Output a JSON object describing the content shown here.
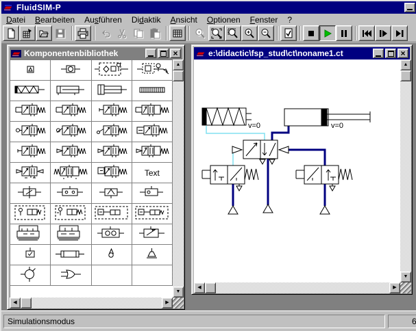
{
  "window": {
    "title": "FluidSIM-P"
  },
  "menu": {
    "items": [
      {
        "name": "datei",
        "pre": "",
        "key": "D",
        "post": "atei"
      },
      {
        "name": "bearbeiten",
        "pre": "",
        "key": "B",
        "post": "earbeiten"
      },
      {
        "name": "ausfuehren",
        "pre": "Au",
        "key": "s",
        "post": "führen"
      },
      {
        "name": "didaktik",
        "pre": "Di",
        "key": "d",
        "post": "aktik"
      },
      {
        "name": "ansicht",
        "pre": "",
        "key": "A",
        "post": "nsicht"
      },
      {
        "name": "optionen",
        "pre": "",
        "key": "O",
        "post": "ptionen"
      },
      {
        "name": "fenster",
        "pre": "",
        "key": "F",
        "post": "enster"
      },
      {
        "name": "hilfe",
        "pre": "?",
        "key": "",
        "post": ""
      }
    ]
  },
  "toolbar": {
    "buttons": [
      {
        "name": "new",
        "icon": "new",
        "state": "normal"
      },
      {
        "name": "new-circuit",
        "icon": "new-circuit",
        "state": "normal"
      },
      {
        "name": "open",
        "icon": "open",
        "state": "normal"
      },
      {
        "name": "save",
        "icon": "save",
        "state": "disabled"
      },
      {
        "sep": true
      },
      {
        "name": "print",
        "icon": "print",
        "state": "normal"
      },
      {
        "sep": true
      },
      {
        "name": "undo",
        "icon": "undo",
        "state": "disabled"
      },
      {
        "name": "cut",
        "icon": "cut",
        "state": "disabled"
      },
      {
        "name": "copy",
        "icon": "copy",
        "state": "disabled"
      },
      {
        "name": "paste",
        "icon": "paste",
        "state": "disabled"
      },
      {
        "sep": true
      },
      {
        "name": "grid",
        "icon": "grid",
        "state": "normal"
      },
      {
        "sep": true
      },
      {
        "name": "zoom-detail",
        "icon": "zoom-detail",
        "state": "disabled"
      },
      {
        "name": "zoom-fit",
        "icon": "zoom-fit",
        "state": "normal"
      },
      {
        "name": "zoom-rect",
        "icon": "zoom-rect",
        "state": "normal"
      },
      {
        "name": "zoom-in",
        "icon": "zoom-in",
        "state": "normal"
      },
      {
        "name": "zoom-out",
        "icon": "zoom-out",
        "state": "normal"
      },
      {
        "sep": true
      },
      {
        "name": "circuit-check",
        "icon": "check",
        "state": "normal"
      },
      {
        "sep": true
      },
      {
        "name": "stop",
        "icon": "stop",
        "state": "normal"
      },
      {
        "name": "play",
        "icon": "play",
        "state": "pressed"
      },
      {
        "name": "pause",
        "icon": "pause",
        "state": "normal"
      },
      {
        "sep": true
      },
      {
        "name": "reset",
        "icon": "seek-start",
        "state": "normal"
      },
      {
        "name": "single-step",
        "icon": "step",
        "state": "normal"
      },
      {
        "name": "sim-to-change",
        "icon": "seek-end",
        "state": "normal"
      }
    ]
  },
  "library": {
    "title": "Komponentenbibliothek",
    "components": [
      {
        "name": "compressed-air-supply",
        "icon": "source"
      },
      {
        "name": "air-service-unit",
        "icon": "service-unit"
      },
      {
        "name": "air-service-unit-detailed",
        "icon": "maintenance"
      },
      {
        "name": "filter-regulator",
        "icon": "filter-reg"
      },
      {
        "name": "single-acting-cylinder",
        "icon": "cyl-single"
      },
      {
        "name": "double-acting-cylinder",
        "icon": "cyl-double"
      },
      {
        "name": "cylinder-with-cushioning",
        "icon": "cyl-cushion"
      },
      {
        "name": "distance-rule",
        "icon": "scale"
      },
      {
        "name": "3-2-way-valve-spring",
        "icon": "v32a"
      },
      {
        "name": "3-2-way-valve-spring-nc",
        "icon": "v32b"
      },
      {
        "name": "3-2-way-valve-spring-no",
        "icon": "v32c"
      },
      {
        "name": "5-2-way-valve-spring",
        "icon": "v52"
      },
      {
        "name": "3-2-roller-valve",
        "icon": "vroll"
      },
      {
        "name": "3-2-roller-valve-no",
        "icon": "vroll2"
      },
      {
        "name": "3-2-roller-lever-valve",
        "icon": "vrolllever"
      },
      {
        "name": "4-2-way-valve",
        "icon": "vbox"
      },
      {
        "name": "3-2-pneumatic-valve",
        "icon": "vpneu"
      },
      {
        "name": "3-2-pilot-valve",
        "icon": "vpilot"
      },
      {
        "name": "3-2-pilot-valve-no",
        "icon": "vpilot2"
      },
      {
        "name": "5-2-pilot-valve",
        "icon": "v52p"
      },
      {
        "name": "5-2-double-pilot-valve",
        "icon": "v52dbl"
      },
      {
        "name": "5-3-way-valve",
        "icon": "v53"
      },
      {
        "name": "3-2-valve-with-pilot-box",
        "icon": "vpbox"
      },
      {
        "name": "text-label",
        "icon": "text",
        "label": "Text"
      },
      {
        "name": "one-way-flow-control",
        "icon": "flowctl"
      },
      {
        "name": "two-pressure-valve",
        "icon": "twopress"
      },
      {
        "name": "quick-exhaust-valve",
        "icon": "quickex"
      },
      {
        "name": "shuttle-valve",
        "icon": "shuttle"
      },
      {
        "name": "throttle-assembly",
        "icon": "dasha"
      },
      {
        "name": "throttle-assembly-2",
        "icon": "dashb"
      },
      {
        "name": "valve-assembly",
        "icon": "dashc"
      },
      {
        "name": "valve-assembly-spring",
        "icon": "dashd"
      },
      {
        "name": "sequencer-module",
        "icon": "cplxa"
      },
      {
        "name": "sequencer-module-2",
        "icon": "cplxb"
      },
      {
        "name": "preset-counter",
        "icon": "counter"
      },
      {
        "name": "pressure-sequence-valve",
        "icon": "seqv"
      },
      {
        "name": "timer",
        "icon": "timer"
      },
      {
        "name": "air-reservoir",
        "icon": "reservoir"
      },
      {
        "name": "nozzle",
        "icon": "nozzle"
      },
      {
        "name": "suction-cup",
        "icon": "suction"
      },
      {
        "name": "vacuum-generator",
        "icon": "vacgen"
      },
      {
        "name": "function-element",
        "icon": "orgate"
      },
      {
        "name": "empty",
        "icon": "empty"
      },
      {
        "name": "empty",
        "icon": "empty"
      }
    ]
  },
  "circuit": {
    "title": "e:\\didactic\\fsp_stud\\ct\\noname1.ct",
    "labels": {
      "left_cylinder_velocity": "v=0",
      "right_cylinder_velocity": "v=0"
    }
  },
  "statusbar": {
    "mode": "Simulationsmodus",
    "right_value": "6"
  },
  "colors": {
    "titlebar_active": "#000080",
    "titlebar_inactive": "#808080",
    "pressure_line": "#000080",
    "signal_line": "#80E0F0",
    "play_green": "#00C000"
  }
}
